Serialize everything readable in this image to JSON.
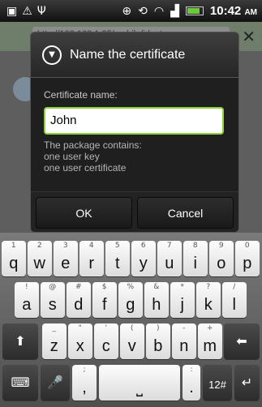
{
  "status_bar": {
    "time": "10:42",
    "ampm": "AM",
    "icons": [
      "sim-icon",
      "warning-icon",
      "usb-icon",
      "gps-icon",
      "sync-icon",
      "wifi-icon",
      "signal-icon",
      "battery-icon"
    ]
  },
  "background": {
    "url": "http://192.168.1.25/mobile/ident"
  },
  "dialog": {
    "title": "Name the certificate",
    "field_label": "Certificate name:",
    "field_value": "John",
    "note_line1": "The package contains:",
    "note_line2": "one user key",
    "note_line3": "one user certificate",
    "ok_label": "OK",
    "cancel_label": "Cancel"
  },
  "keyboard": {
    "row1": [
      {
        "alt": "1",
        "main": "q"
      },
      {
        "alt": "2",
        "main": "w"
      },
      {
        "alt": "3",
        "main": "e"
      },
      {
        "alt": "4",
        "main": "r"
      },
      {
        "alt": "5",
        "main": "t"
      },
      {
        "alt": "6",
        "main": "y"
      },
      {
        "alt": "7",
        "main": "u"
      },
      {
        "alt": "8",
        "main": "i"
      },
      {
        "alt": "9",
        "main": "o"
      },
      {
        "alt": "0",
        "main": "p"
      }
    ],
    "row2": [
      {
        "alt": "!",
        "main": "a"
      },
      {
        "alt": "@",
        "main": "s"
      },
      {
        "alt": "#",
        "main": "d"
      },
      {
        "alt": "$",
        "main": "f"
      },
      {
        "alt": "%",
        "main": "g"
      },
      {
        "alt": "&",
        "main": "h"
      },
      {
        "alt": "*",
        "main": "j"
      },
      {
        "alt": "?",
        "main": "k"
      },
      {
        "alt": "/",
        "main": "l"
      }
    ],
    "row3": [
      {
        "alt": "_",
        "main": "z"
      },
      {
        "alt": "\"",
        "main": "x"
      },
      {
        "alt": "'",
        "main": "c"
      },
      {
        "alt": "(",
        "main": "v"
      },
      {
        "alt": ")",
        "main": "b"
      },
      {
        "alt": "-",
        "main": "n"
      },
      {
        "alt": "+",
        "main": "m"
      }
    ],
    "comma": {
      "alt": ";",
      "main": ","
    },
    "period": {
      "alt": ":",
      "main": "."
    },
    "symbols_label": "12#"
  }
}
